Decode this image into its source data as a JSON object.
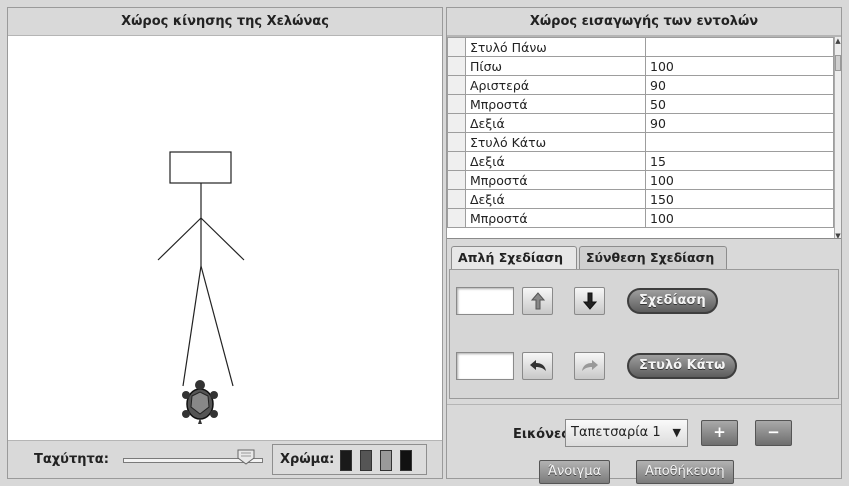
{
  "left": {
    "title": "Χώρος κίνησης της Χελώνας",
    "speed_label": "Ταχύτητα:",
    "speed_value": 0.88,
    "color_label": "Χρώμα:",
    "swatches": [
      "#1a1a1a",
      "#555555",
      "#9a9a9a",
      "#111111"
    ]
  },
  "right": {
    "title": "Χώρος εισαγωγής των εντολών",
    "commands": [
      {
        "cmd": "Στυλό Πάνω",
        "val": ""
      },
      {
        "cmd": "Πίσω",
        "val": "100"
      },
      {
        "cmd": "Αριστερά",
        "val": "90"
      },
      {
        "cmd": "Μπροστά",
        "val": "50"
      },
      {
        "cmd": "Δεξιά",
        "val": "90"
      },
      {
        "cmd": "Στυλό Κάτω",
        "val": ""
      },
      {
        "cmd": "Δεξιά",
        "val": "15"
      },
      {
        "cmd": "Μπροστά",
        "val": "100"
      },
      {
        "cmd": "Δεξιά",
        "val": "150"
      },
      {
        "cmd": "Μπροστά",
        "val": "100"
      }
    ],
    "tabs": [
      "Απλή Σχεδίαση",
      "Σύνθεση Σχεδίαση"
    ],
    "draw_button": "Σχεδίαση",
    "pen_down_button": "Στυλό Κάτω",
    "images_label": "Εικόνες:",
    "images_selected": "Ταπετσαρία 1",
    "plus_button": "+",
    "minus_button": "−",
    "open_button": "Άνοιγμα",
    "save_button": "Αποθήκευση"
  },
  "icons": {
    "up": "arrow-up-icon",
    "down": "arrow-down-icon",
    "undo": "undo-icon",
    "redo": "redo-icon",
    "turtle": "turtle-icon"
  }
}
